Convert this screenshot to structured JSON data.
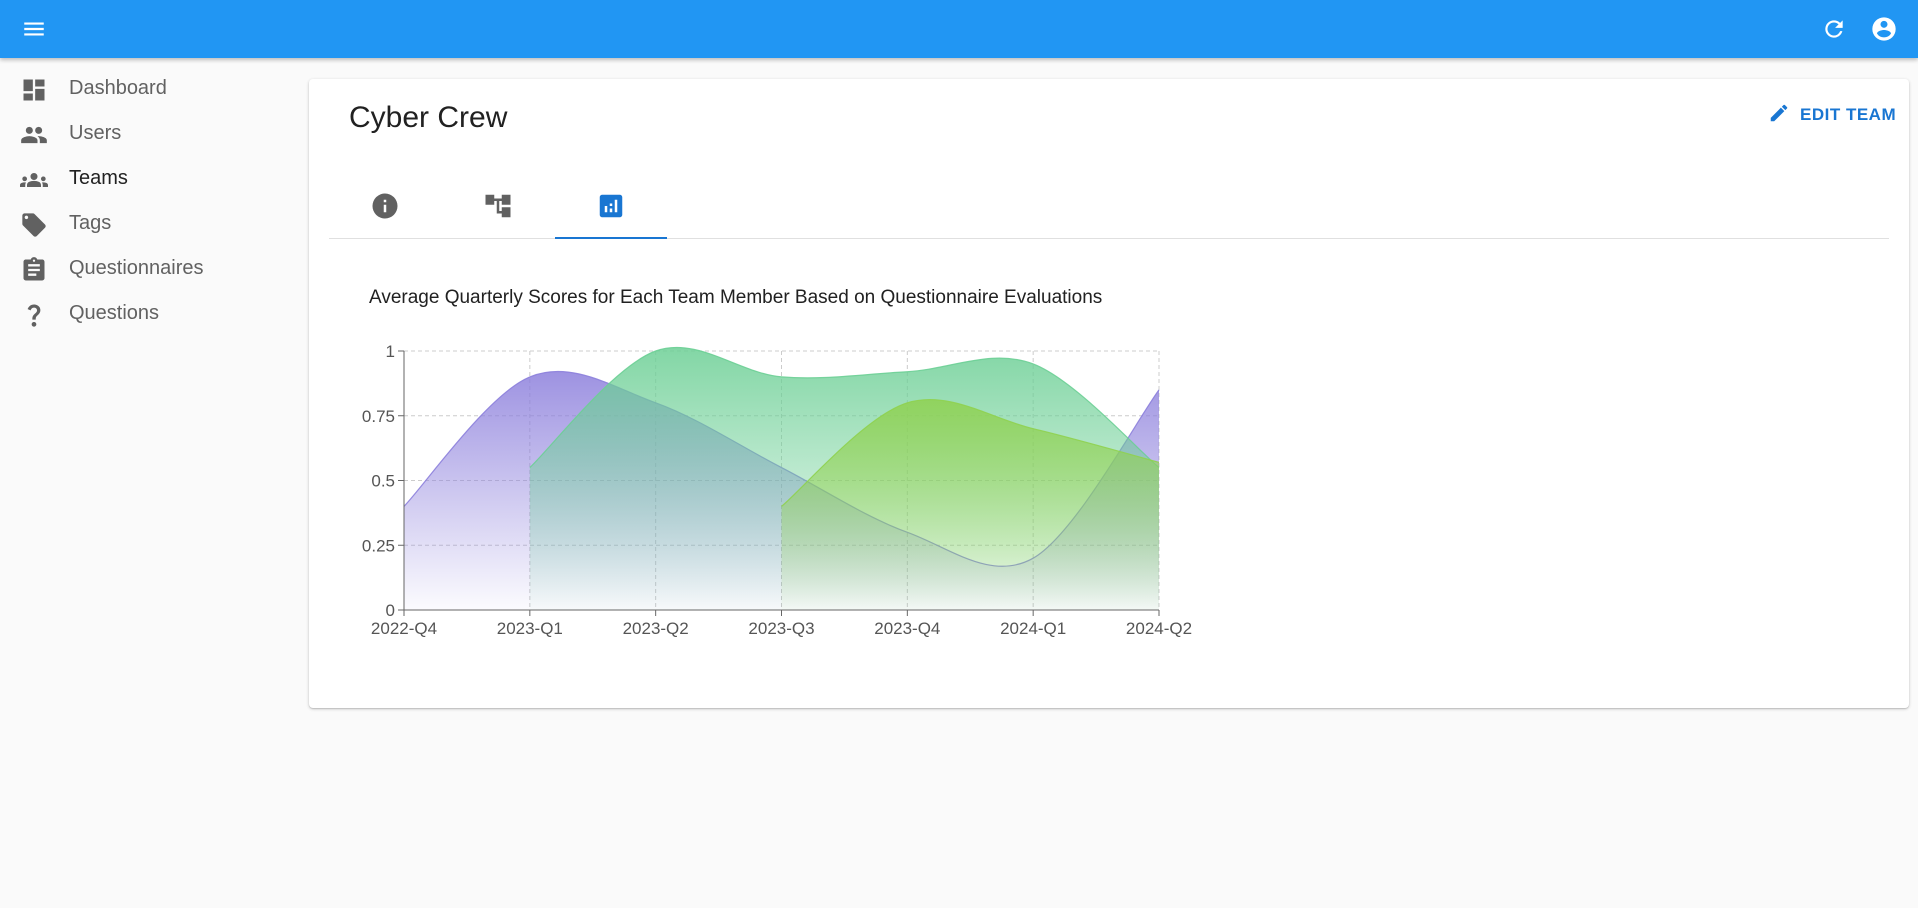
{
  "appbar": {
    "menu_icon": "menu-icon",
    "refresh_icon": "refresh-icon",
    "account_icon": "account-circle-icon",
    "color": "#2196f3"
  },
  "sidebar": {
    "items": [
      {
        "label": "Dashboard",
        "icon": "dashboard-icon"
      },
      {
        "label": "Users",
        "icon": "users-icon"
      },
      {
        "label": "Teams",
        "icon": "teams-icon",
        "active": true
      },
      {
        "label": "Tags",
        "icon": "tag-icon"
      },
      {
        "label": "Questionnaires",
        "icon": "clipboard-icon"
      },
      {
        "label": "Questions",
        "icon": "question-mark-icon"
      }
    ]
  },
  "team": {
    "title": "Cyber Crew",
    "edit_label": "EDIT TEAM"
  },
  "tabs": [
    {
      "icon": "info-icon",
      "active": false
    },
    {
      "icon": "hierarchy-icon",
      "active": false
    },
    {
      "icon": "bar-chart-icon",
      "active": true
    }
  ],
  "chart_data": {
    "type": "area",
    "title": "Average Quarterly Scores for Each Team Member Based on Questionnaire Evaluations",
    "x": [
      "2022-Q4",
      "2023-Q1",
      "2023-Q2",
      "2023-Q3",
      "2023-Q4",
      "2024-Q1",
      "2024-Q2"
    ],
    "ylim": [
      0,
      1
    ],
    "yticks": [
      "0",
      "0.25",
      "0.5",
      "0.75",
      "1"
    ],
    "grid": true,
    "series": [
      {
        "color": "#8c7fdc",
        "values": [
          0.4,
          0.9,
          0.8,
          0.55,
          0.3,
          0.2,
          0.85
        ]
      },
      {
        "color": "#6ccf95",
        "values": [
          null,
          0.55,
          1.0,
          0.9,
          0.92,
          0.95,
          0.55
        ]
      },
      {
        "color": "#8fd14f",
        "values": [
          null,
          null,
          null,
          0.4,
          0.8,
          0.7,
          0.57
        ]
      }
    ]
  }
}
